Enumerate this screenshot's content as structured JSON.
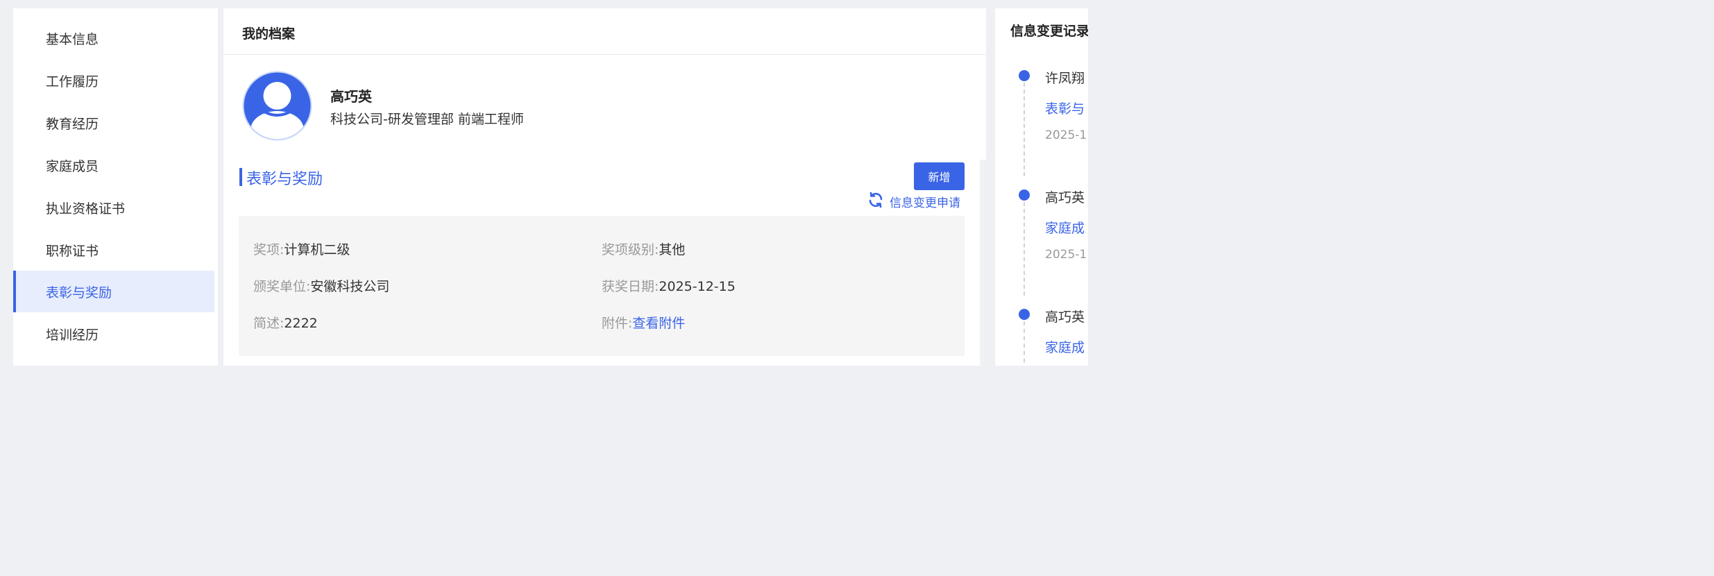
{
  "nav": {
    "items": [
      {
        "label": "基本信息"
      },
      {
        "label": "工作履历"
      },
      {
        "label": "教育经历"
      },
      {
        "label": "家庭成员"
      },
      {
        "label": "执业资格证书"
      },
      {
        "label": "职称证书"
      },
      {
        "label": "表彰与奖励",
        "active": true
      },
      {
        "label": "培训经历"
      }
    ]
  },
  "main": {
    "title": "我的档案",
    "user": {
      "name": "高巧英",
      "dept": "科技公司-研发管理部 前端工程师"
    },
    "section_title": "表彰与奖励",
    "add_label": "新增",
    "change_request_label": "信息变更申请",
    "fields": {
      "award": {
        "label": "奖项:",
        "value": "计算机二级"
      },
      "level": {
        "label": "奖项级别:",
        "value": "其他"
      },
      "issuer": {
        "label": "颁奖单位:",
        "value": "安徽科技公司"
      },
      "date": {
        "label": "获奖日期:",
        "value": "2025-12-15"
      },
      "desc": {
        "label": "简述:",
        "value": "2222"
      },
      "attachment": {
        "label": "附件:",
        "value": "查看附件"
      }
    }
  },
  "history": {
    "title": "信息变更记录",
    "entries": [
      {
        "name": "许凤翔",
        "section": "表彰与",
        "time": "2025-1"
      },
      {
        "name": "高巧英",
        "section": "家庭成",
        "time": "2025-1"
      },
      {
        "name": "高巧英",
        "section": "家庭成",
        "time": ""
      }
    ]
  },
  "colors": {
    "accent": "#3a64e6",
    "nav_active_bg": "#e8edfd",
    "detail_bg": "#f5f5f6"
  },
  "icons": [
    "avatar-icon",
    "refresh-icon"
  ]
}
